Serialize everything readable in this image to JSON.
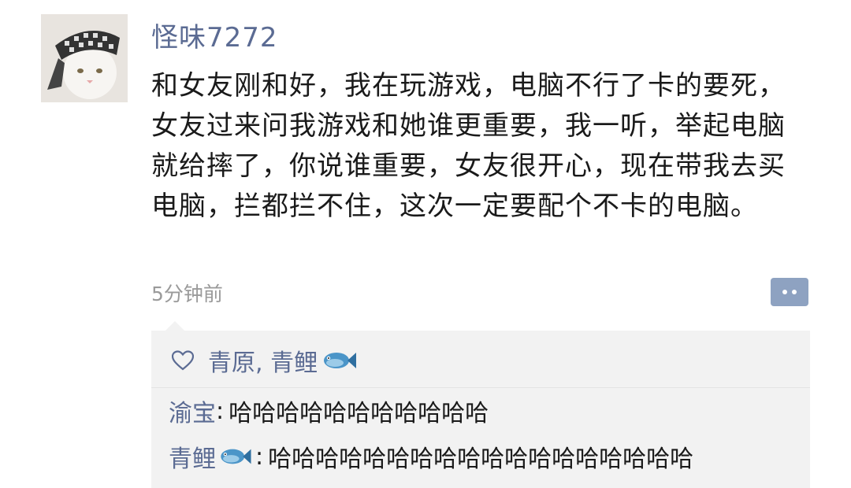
{
  "post": {
    "username": "怪味7272",
    "body": "和女友刚和好，我在玩游戏，电脑不行了卡的要死，女友过来问我游戏和她谁更重要，我一听，举起电脑就给摔了，你说谁重要，女友很开心，现在带我去买电脑，拦都拦不住，这次一定要配个不卡的电脑。",
    "timestamp": "5分钟前"
  },
  "likes": {
    "names": "青原, 青鲤",
    "icon": "fish-emoji"
  },
  "comments": [
    {
      "author": "渝宝",
      "colon": ":",
      "text": "哈哈哈哈哈哈哈哈哈哈哈"
    },
    {
      "author": "青鲤",
      "author_icon": "fish-emoji",
      "colon": ":",
      "text": "哈哈哈哈哈哈哈哈哈哈哈哈哈哈哈哈哈哈"
    }
  ],
  "colors": {
    "name_blue": "#5b6b93",
    "comment_bg": "#f2f2f2",
    "more_button": "#8ea2c1"
  }
}
